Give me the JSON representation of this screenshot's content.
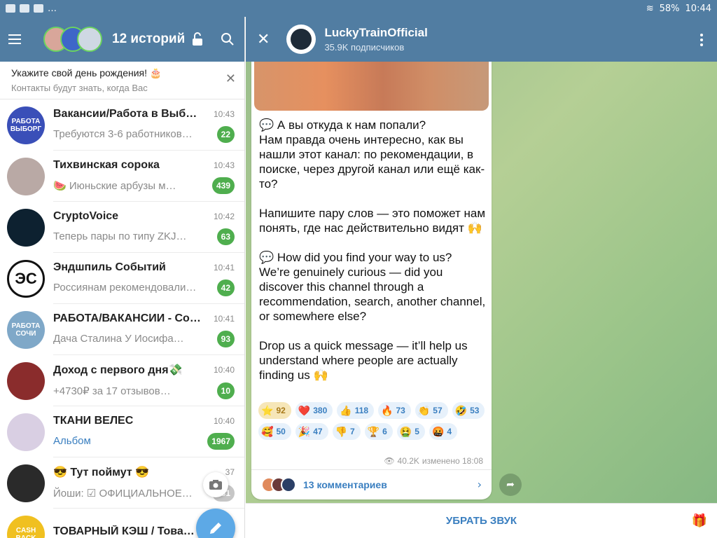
{
  "status_bar": {
    "battery": "58%",
    "time": "10:44"
  },
  "left_header": {
    "stories_title": "12 историй"
  },
  "birthday_banner": {
    "title": "Укажите свой день рождения! 🎂",
    "subtitle": "Контакты будут знать, когда Вас"
  },
  "chats": [
    {
      "name": "Вакансии/Работа в Выб…",
      "time": "10:43",
      "preview": "Требуются 3-6 работников…",
      "count": "22",
      "avatar_text": "РАБОТА ВЫБОРГ",
      "avatar_color": "#3a4fb8"
    },
    {
      "name": "Тихвинская сорока",
      "time": "10:43",
      "preview": "🍉 Июньские арбузы м…",
      "count": "439",
      "avatar_color": "#b9a9a5"
    },
    {
      "name": "CryptoVoice",
      "time": "10:42",
      "preview": "Теперь пары по типу ZKJ…",
      "count": "63",
      "avatar_color": "#0d2130"
    },
    {
      "name": "Эндшпиль Событий",
      "time": "10:41",
      "preview": "Россиянам рекомендовали…",
      "count": "42",
      "avatar_text": "ЭС",
      "avatar_color": "#ffffff"
    },
    {
      "name": "РАБОТА/ВАКАНСИИ - Со…",
      "time": "10:41",
      "preview": "Дача Сталина  У Иосифа…",
      "count": "93",
      "avatar_text": "РАБОТА СОЧИ",
      "avatar_color": "#7fa8c8"
    },
    {
      "name": "Доход с первого дня💸",
      "time": "10:40",
      "preview": "+4730₽ за 17 отзывов…",
      "count": "10",
      "avatar_color": "#8a2c2c"
    },
    {
      "name": "ТКАНИ ВЕЛЕС",
      "time": "10:40",
      "preview": "Альбом",
      "count": "1967",
      "avatar_color": "#d9cfe3"
    },
    {
      "name": "😎 Тут поймут 😎",
      "time": "37",
      "preview": "Йоши: ☑ ОФИЦИАЛЬНОЕ…",
      "count": "231",
      "avatar_color": "#2a2a2a"
    },
    {
      "name": "ТОВАРНЫЙ КЭШ / Това…",
      "time": "33",
      "preview": "",
      "count": "",
      "avatar_text": "CASH BACK",
      "avatar_color": "#f0c020"
    }
  ],
  "channel": {
    "name": "LuckyTrainOfficial",
    "subscribers": "35.9K подписчиков"
  },
  "message": {
    "text": "💬 А вы откуда к нам попали?\nНам правда очень интересно, как вы нашли этот канал: по рекомендации, в поиске, через другой канал или ещё как-то?\n\nНапишите пару слов — это поможет нам понять, где нас действительно видят 🙌\n\n💬 How did you find your way to us?\nWe’re genuinely curious — did you discover this channel through a recommendation, search, another channel, or somewhere else?\n\nDrop us a quick message — it’ll help us understand where people are actually finding us 🙌",
    "views": "40.2K",
    "edited": "изменено 18:08",
    "comments": "13 комментариев"
  },
  "reactions": [
    {
      "emoji": "⭐",
      "count": "92"
    },
    {
      "emoji": "❤️",
      "count": "380"
    },
    {
      "emoji": "👍",
      "count": "118"
    },
    {
      "emoji": "🔥",
      "count": "73"
    },
    {
      "emoji": "👏",
      "count": "57"
    },
    {
      "emoji": "🤣",
      "count": "53"
    },
    {
      "emoji": "🥰",
      "count": "50"
    },
    {
      "emoji": "🎉",
      "count": "47"
    },
    {
      "emoji": "👎",
      "count": "7"
    },
    {
      "emoji": "🏆",
      "count": "6"
    },
    {
      "emoji": "🤮",
      "count": "5"
    },
    {
      "emoji": "🤬",
      "count": "4"
    }
  ],
  "bottom_bar": {
    "mute_label": "УБРАТЬ ЗВУК"
  }
}
